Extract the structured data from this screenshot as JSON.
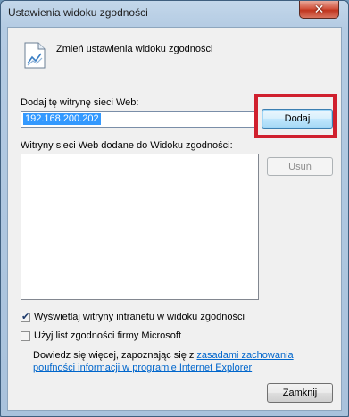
{
  "window": {
    "title": "Ustawienia widoku zgodności",
    "close_glyph": "✕"
  },
  "header": {
    "text": "Zmień ustawienia widoku zgodności",
    "icon": "document-chart-icon"
  },
  "add_section": {
    "label": "Dodaj tę witrynę sieci Web:",
    "input_value": "192.168.200.202",
    "add_button": "Dodaj"
  },
  "list_section": {
    "label": "Witryny sieci Web dodane do Widoku zgodności:",
    "items": [],
    "remove_button": "Usuń"
  },
  "options": {
    "intranet": {
      "label": "Wyświetlaj witryny intranetu w widoku zgodności",
      "checked": true
    },
    "microsoft_list": {
      "label": "Użyj list zgodności firmy Microsoft",
      "checked": false
    }
  },
  "info": {
    "text": "Dowiedz się więcej, zapoznając się z ",
    "link": "zasadami zachowania poufności informacji w programie Internet Explorer"
  },
  "footer": {
    "close_button": "Zamknij"
  },
  "colors": {
    "highlight": "#d0202e",
    "selection": "#3399ff",
    "link": "#0066cc"
  }
}
